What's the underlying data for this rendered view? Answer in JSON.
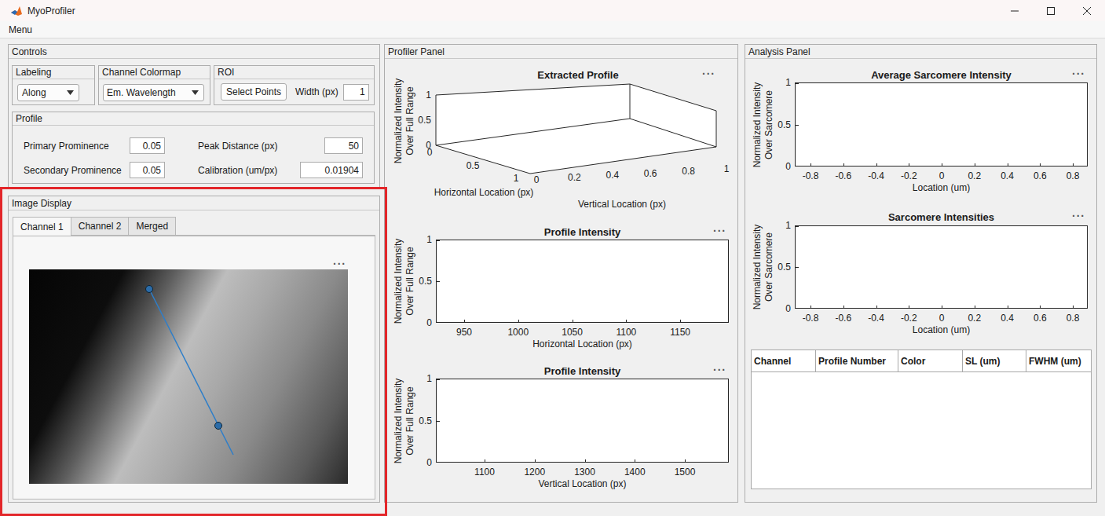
{
  "window": {
    "title": "MyoProfiler"
  },
  "menu": [
    {
      "label": "Menu"
    }
  ],
  "controls": {
    "title": "Controls",
    "labeling": {
      "title": "Labeling",
      "value": "Along"
    },
    "colormap": {
      "title": "Channel Colormap",
      "value": "Em. Wavelength"
    },
    "roi": {
      "title": "ROI",
      "button": "Select Points",
      "width_label": "Width (px)",
      "width_value": "1"
    },
    "profile": {
      "title": "Profile",
      "fields": [
        {
          "label": "Primary Prominence",
          "value": "0.05"
        },
        {
          "label": "Peak Distance (px)",
          "value": "50"
        },
        {
          "label": "Secondary Prominence",
          "value": "0.05"
        },
        {
          "label": "Calibration (um/px)",
          "value": "0.01904"
        }
      ]
    }
  },
  "image_display": {
    "title": "Image Display",
    "highlighted": true,
    "toolbar": "···",
    "tabs": [
      {
        "label": "Channel 1",
        "selected": true
      },
      {
        "label": "Channel 2",
        "selected": false
      },
      {
        "label": "Merged",
        "selected": false
      }
    ]
  },
  "profiler": {
    "title": "Profiler Panel",
    "charts": [
      {
        "kind": "3d",
        "title": "Extracted Profile",
        "toolbar": "···",
        "z_label": [
          "Normalized Intensity",
          "Over Full Range"
        ],
        "z_ticks": [
          "0",
          "0.5",
          "1"
        ],
        "x_label": "Horizontal Location (px)",
        "x_ticks": [
          "0",
          "0.5",
          "1"
        ],
        "y_label": "Vertical Location (px)",
        "y_ticks": [
          "0",
          "0.2",
          "0.4",
          "0.6",
          "0.8",
          "1"
        ]
      },
      {
        "kind": "2d",
        "title": "Profile Intensity",
        "toolbar": "···",
        "y_label": [
          "Normalized Intensity",
          "Over Full Range"
        ],
        "y_ticks": [
          "0",
          "0.5",
          "1"
        ],
        "y_limits": [
          0,
          1
        ],
        "x_label": "Horizontal Location (px)",
        "x_ticks": [
          "950",
          "1000",
          "1050",
          "1100",
          "1150"
        ],
        "x_limits": [
          923.8,
          1195
        ]
      },
      {
        "kind": "2d",
        "title": "Profile Intensity",
        "toolbar": "···",
        "y_label": [
          "Normalized Intensity",
          "Over Full Range"
        ],
        "y_ticks": [
          "0",
          "0.5",
          "1"
        ],
        "y_limits": [
          0,
          1
        ],
        "x_label": "Vertical Location (px)",
        "x_ticks": [
          "1100",
          "1200",
          "1300",
          "1400",
          "1500"
        ],
        "x_limits": [
          1002.7,
          1587.8
        ]
      }
    ]
  },
  "analysis": {
    "title": "Analysis Panel",
    "charts": [
      {
        "kind": "2d",
        "title": "Average Sarcomere Intensity",
        "toolbar": "···",
        "y_label": [
          "Normalized Intensity",
          "Over Sarcomere"
        ],
        "y_ticks": [
          "0",
          "0.5",
          "1"
        ],
        "y_limits": [
          0,
          1
        ],
        "x_label": "Location (um)",
        "x_ticks": [
          "-0.8",
          "-0.6",
          "-0.4",
          "-0.2",
          "0",
          "0.2",
          "0.4",
          "0.6",
          "0.8"
        ],
        "x_limits": [
          -0.896,
          0.891
        ]
      },
      {
        "kind": "2d",
        "title": "Sarcomere Intensities",
        "toolbar": "···",
        "y_label": [
          "Normalized Intensity",
          "Over Sarcomere"
        ],
        "y_ticks": [
          "0",
          "0.5",
          "1"
        ],
        "y_limits": [
          0,
          1
        ],
        "x_label": "Location (um)",
        "x_ticks": [
          "-0.8",
          "-0.6",
          "-0.4",
          "-0.2",
          "0",
          "0.2",
          "0.4",
          "0.6",
          "0.8"
        ],
        "x_limits": [
          -0.896,
          0.891
        ]
      }
    ],
    "table": {
      "columns": [
        "Channel",
        "Profile Number",
        "Color",
        "SL (um)",
        "FWHM (um)"
      ],
      "rows": []
    }
  }
}
